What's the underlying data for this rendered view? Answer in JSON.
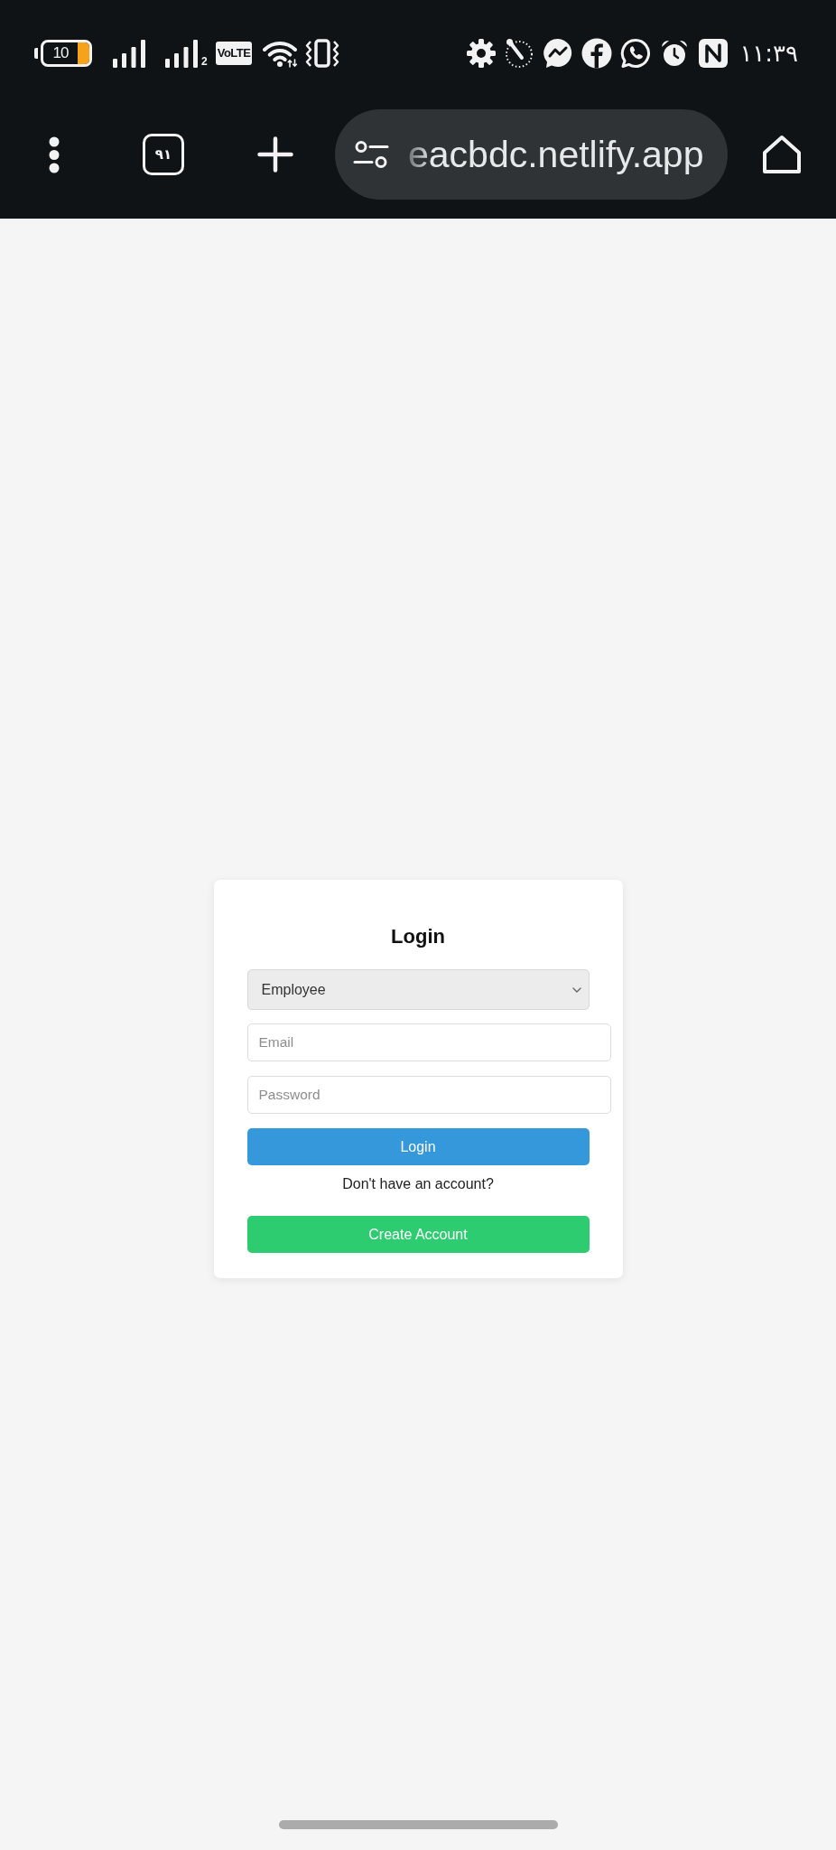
{
  "status_bar": {
    "battery_text": "10",
    "sim_label": "2",
    "network_badge": "VoLTE",
    "time": "١١:٣٩"
  },
  "browser_toolbar": {
    "tab_count": "٩١",
    "url": "eacbdc.netlify.app"
  },
  "login_card": {
    "title": "Login",
    "role_select": {
      "value": "Employee"
    },
    "email_field": {
      "placeholder": "Email"
    },
    "password_field": {
      "placeholder": "Password"
    },
    "login_button": "Login",
    "signup_prompt": "Don't have an account?",
    "create_account_button": "Create Account"
  }
}
